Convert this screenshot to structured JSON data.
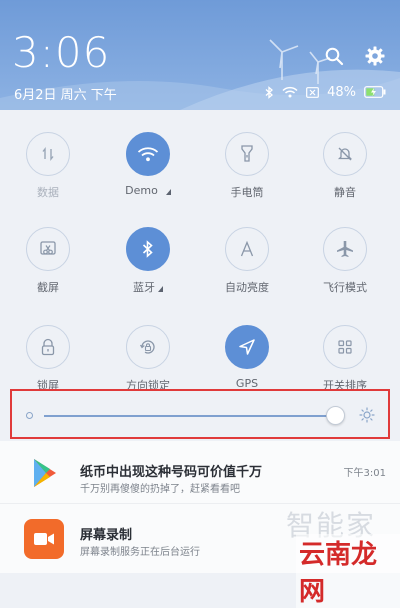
{
  "header": {
    "time": "3:06",
    "date": "6月2日 周六 下午",
    "battery": "48%"
  },
  "icons": {
    "search": "search-icon",
    "settings": "gear-icon",
    "bluetooth": "bluetooth-icon",
    "wifi": "wifi-icon",
    "sim": "no-sim-icon",
    "battery": "battery-charging-icon"
  },
  "colors": {
    "accent": "#5d8fd6",
    "header": "#7ea6dd",
    "highlight_border": "#e03a3a"
  },
  "toggles": [
    {
      "label": "数据",
      "icon": "mobile-data-icon",
      "active": false
    },
    {
      "label": "Demo",
      "icon": "wifi-icon",
      "active": true
    },
    {
      "label": "手电筒",
      "icon": "flashlight-icon",
      "active": false
    },
    {
      "label": "静音",
      "icon": "bell-mute-icon",
      "active": false
    },
    {
      "label": "截屏",
      "icon": "screenshot-scissors-icon",
      "active": false
    },
    {
      "label": "蓝牙",
      "icon": "bluetooth-icon",
      "active": true
    },
    {
      "label": "自动亮度",
      "icon": "auto-brightness-icon",
      "active": false
    },
    {
      "label": "飞行模式",
      "icon": "airplane-icon",
      "active": false
    },
    {
      "label": "锁屏",
      "icon": "lock-icon",
      "active": false
    },
    {
      "label": "方向锁定",
      "icon": "rotation-lock-icon",
      "active": false
    },
    {
      "label": "GPS",
      "icon": "gps-icon",
      "active": true
    },
    {
      "label": "开关排序",
      "icon": "grid-sort-icon",
      "active": false
    }
  ],
  "brightness": {
    "level": 0.97
  },
  "notifications": [
    {
      "title": "纸币中出现这种号码可价值千万",
      "body": "千万别再傻傻的扔掉了，赶紧看看吧",
      "time": "下午3:01",
      "icon": "play-store-icon"
    },
    {
      "title": "屏幕录制",
      "body": "屏幕录制服务正在后台运行",
      "time": "",
      "icon": "video-camera-icon"
    }
  ],
  "watermarks": {
    "w1": "智能家",
    "w2": "云南龙网"
  }
}
